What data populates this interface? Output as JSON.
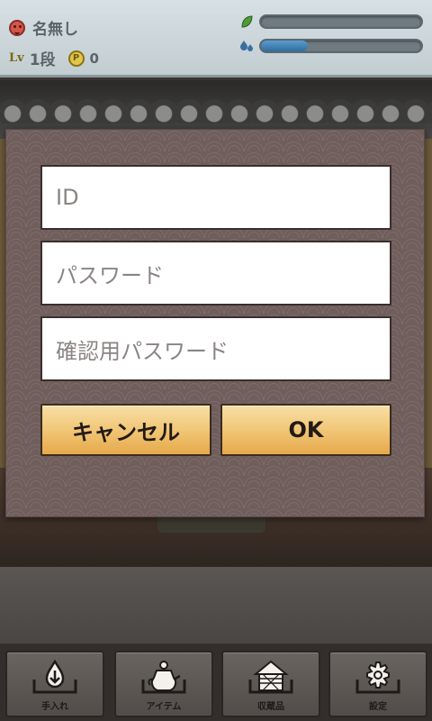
{
  "status": {
    "player_name": "名無し",
    "level_label": "Lv",
    "rank": "1段",
    "points_icon_label": "P",
    "points": "0",
    "gauges": [
      {
        "icon": "leaf-icon",
        "level": 0.0,
        "color": "#5a9bcf"
      },
      {
        "icon": "water-drops-icon",
        "level": 0.29,
        "color": "#3b7fb3"
      }
    ]
  },
  "dialog": {
    "id_placeholder": "ID",
    "password_placeholder": "パスワード",
    "confirm_placeholder": "確認用パスワード",
    "cancel_label": "キャンセル",
    "ok_label": "OK"
  },
  "nav": {
    "items": [
      {
        "label": "手入れ",
        "icon": "water-drop-icon"
      },
      {
        "label": "アイテム",
        "icon": "teapot-icon"
      },
      {
        "label": "収蔵品",
        "icon": "storehouse-icon"
      },
      {
        "label": "設定",
        "icon": "gear-icon"
      }
    ]
  },
  "colors": {
    "button_gradient_top": "#f7dfa6",
    "button_gradient_bottom": "#e6a94b",
    "dialog_bg": "#6f5e5b",
    "gauge_fill": "#3b7fb3"
  }
}
